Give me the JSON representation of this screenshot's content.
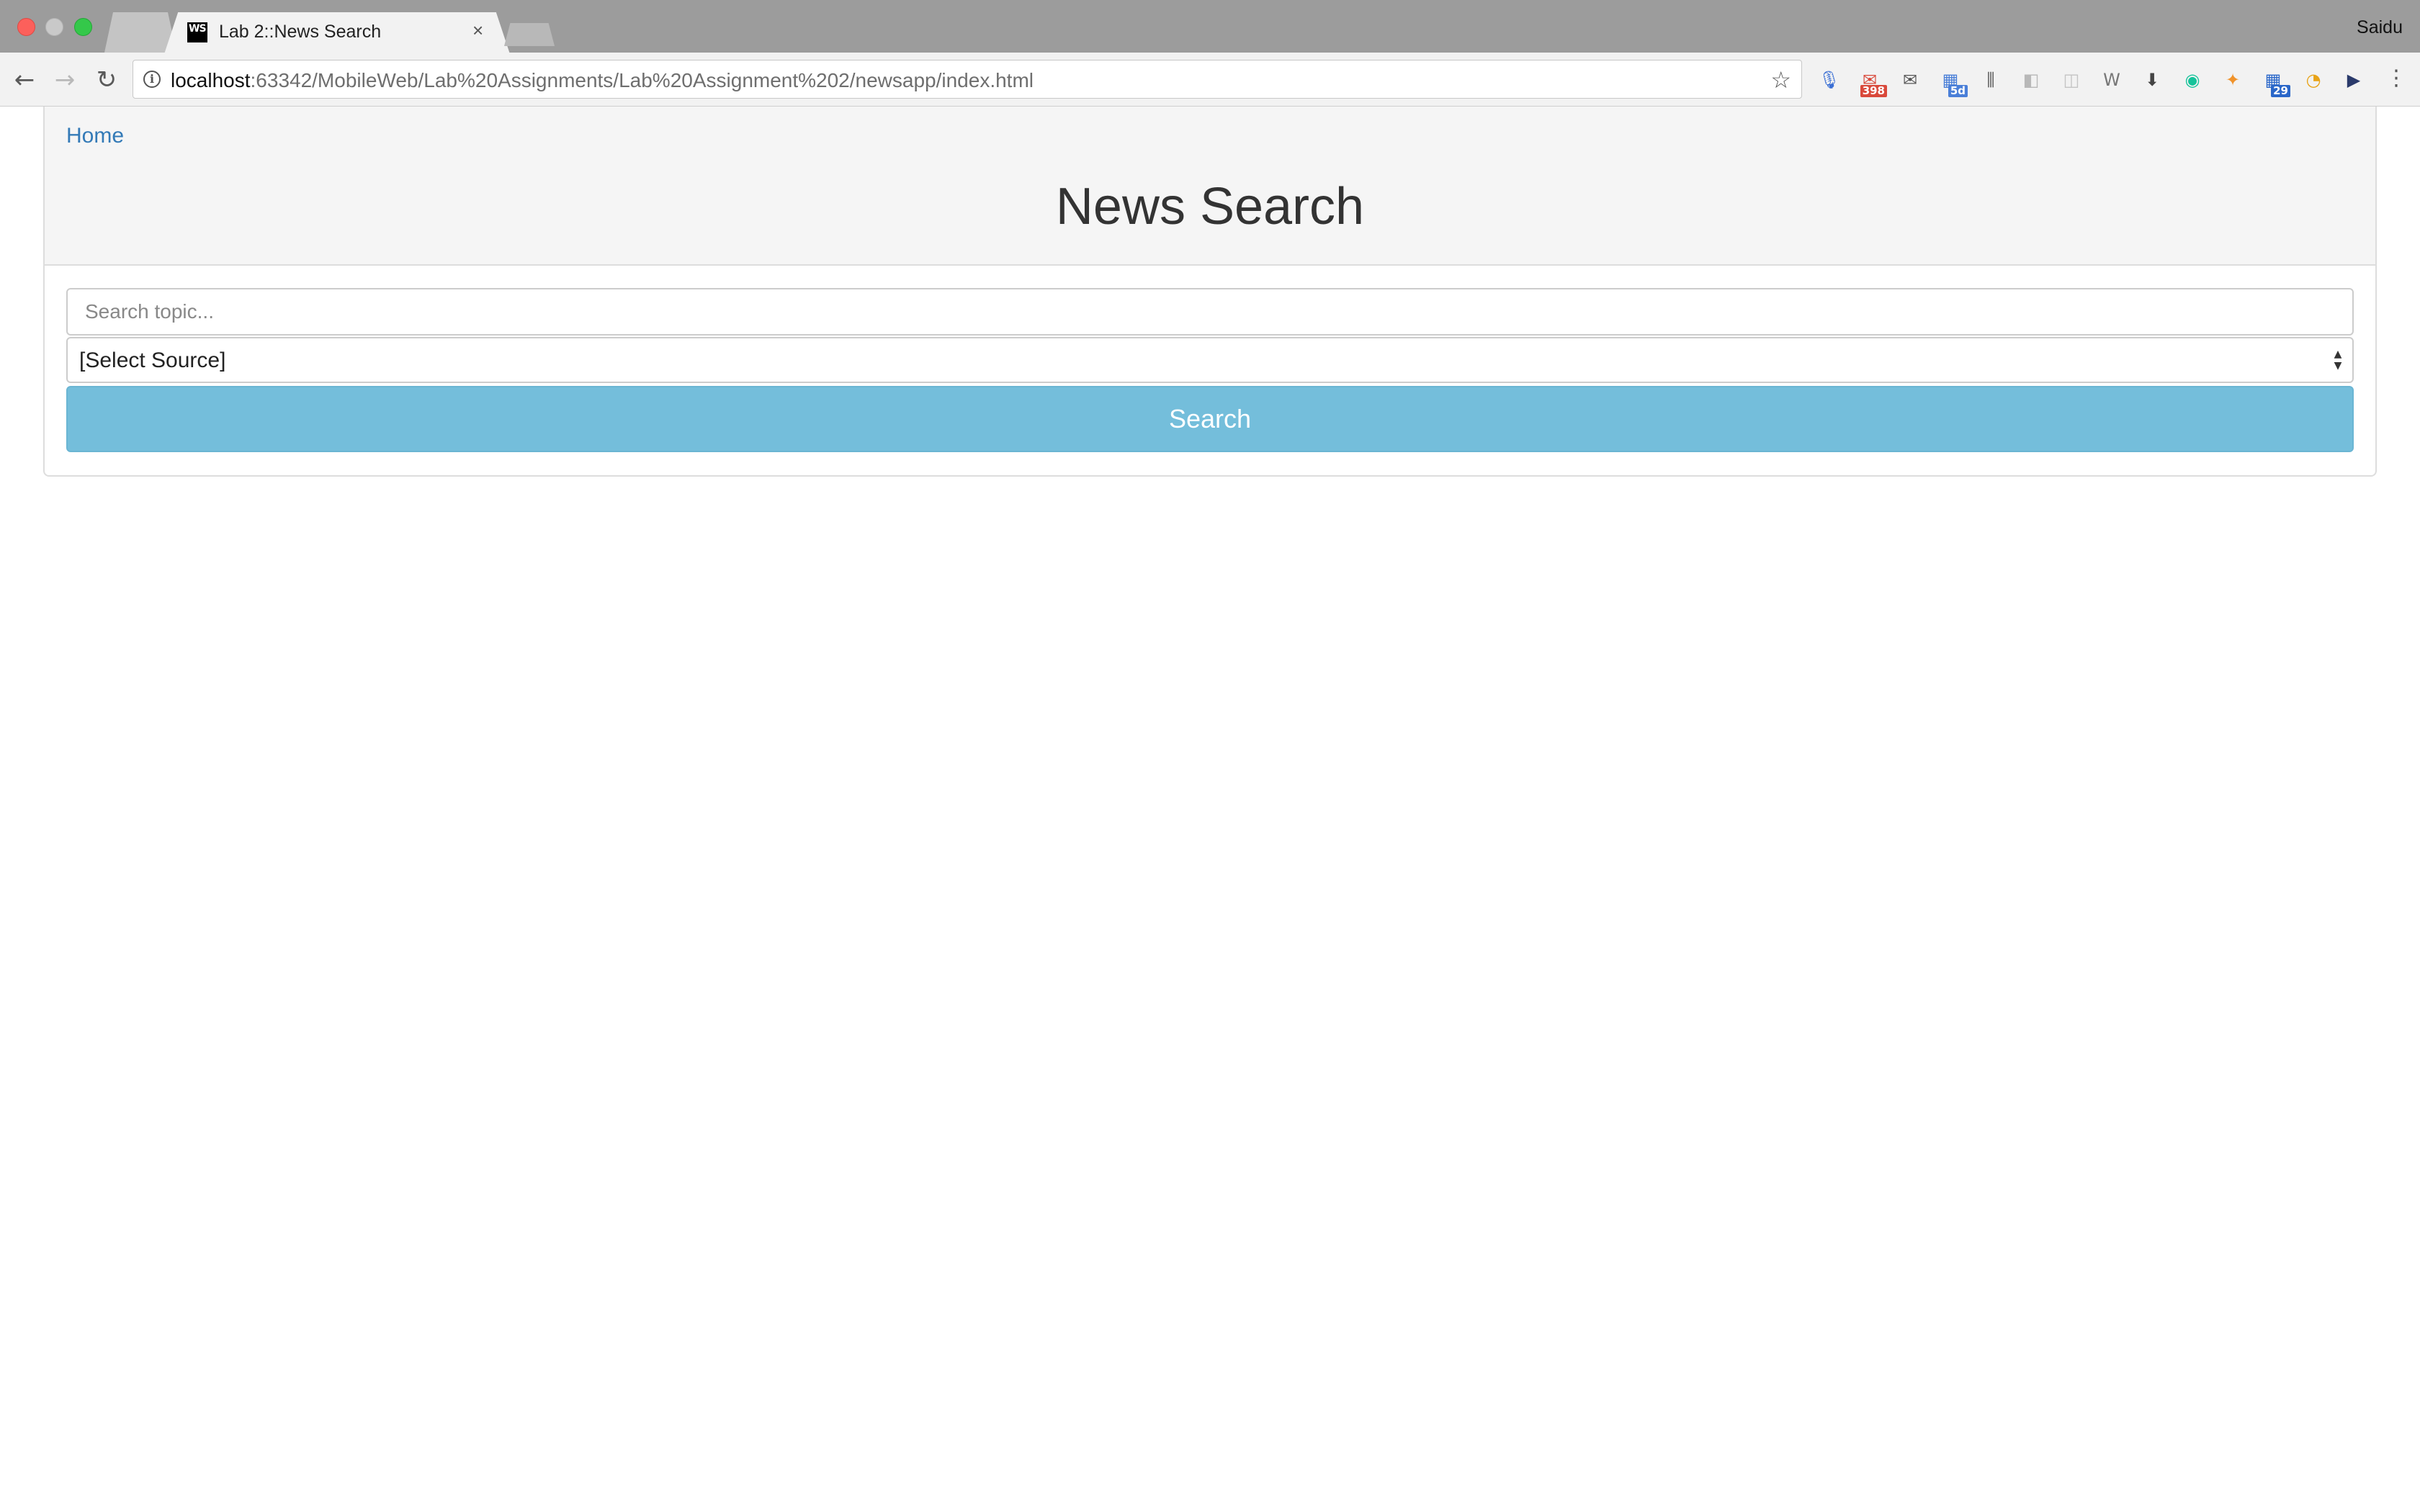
{
  "browser": {
    "tab_title": "Lab 2::News Search",
    "tab_favicon_text": "WS",
    "tab_close": "×",
    "profile_name": "Saidu",
    "url_host": "localhost",
    "url_path": ":63342/MobileWeb/Lab%20Assignments/Lab%20Assignment%202/newsapp/index.html",
    "extensions": [
      {
        "name": "microphone-icon",
        "glyph": "🎙",
        "color": "#3b6fd4"
      },
      {
        "name": "gmail-icon",
        "glyph": "✉",
        "color": "#d9493b",
        "badge": "398",
        "badge_color": "#d9493b"
      },
      {
        "name": "mail-icon",
        "glyph": "✉",
        "color": "#555555"
      },
      {
        "name": "calendar-icon",
        "glyph": "▦",
        "color": "#4a7fd8",
        "badge": "5d",
        "badge_color": "#4a7fd8"
      },
      {
        "name": "equalizer-icon",
        "glyph": "⫼",
        "color": "#555555"
      },
      {
        "name": "extension-icon",
        "glyph": "◧",
        "color": "#b8b8b8"
      },
      {
        "name": "extension-disabled-icon",
        "glyph": "◫",
        "color": "#c4c4c4"
      },
      {
        "name": "w-icon",
        "glyph": "W",
        "color": "#777777"
      },
      {
        "name": "download-icon",
        "glyph": "⬇",
        "color": "#444444"
      },
      {
        "name": "grammarly-icon",
        "glyph": "◉",
        "color": "#15c39a"
      },
      {
        "name": "colorful-icon",
        "glyph": "✦",
        "color": "#f0932b"
      },
      {
        "name": "calendar-29-icon",
        "glyph": "▦",
        "color": "#2a67c9",
        "badge": "29",
        "badge_color": "#2a67c9"
      },
      {
        "name": "compass-icon",
        "glyph": "◔",
        "color": "#e8a317"
      },
      {
        "name": "play-icon",
        "glyph": "▶",
        "color": "#2a3a6b"
      }
    ]
  },
  "page": {
    "home_link": "Home",
    "title": "News Search",
    "search_placeholder": "Search topic...",
    "source_selected": "[Select Source]",
    "search_button": "Search"
  }
}
